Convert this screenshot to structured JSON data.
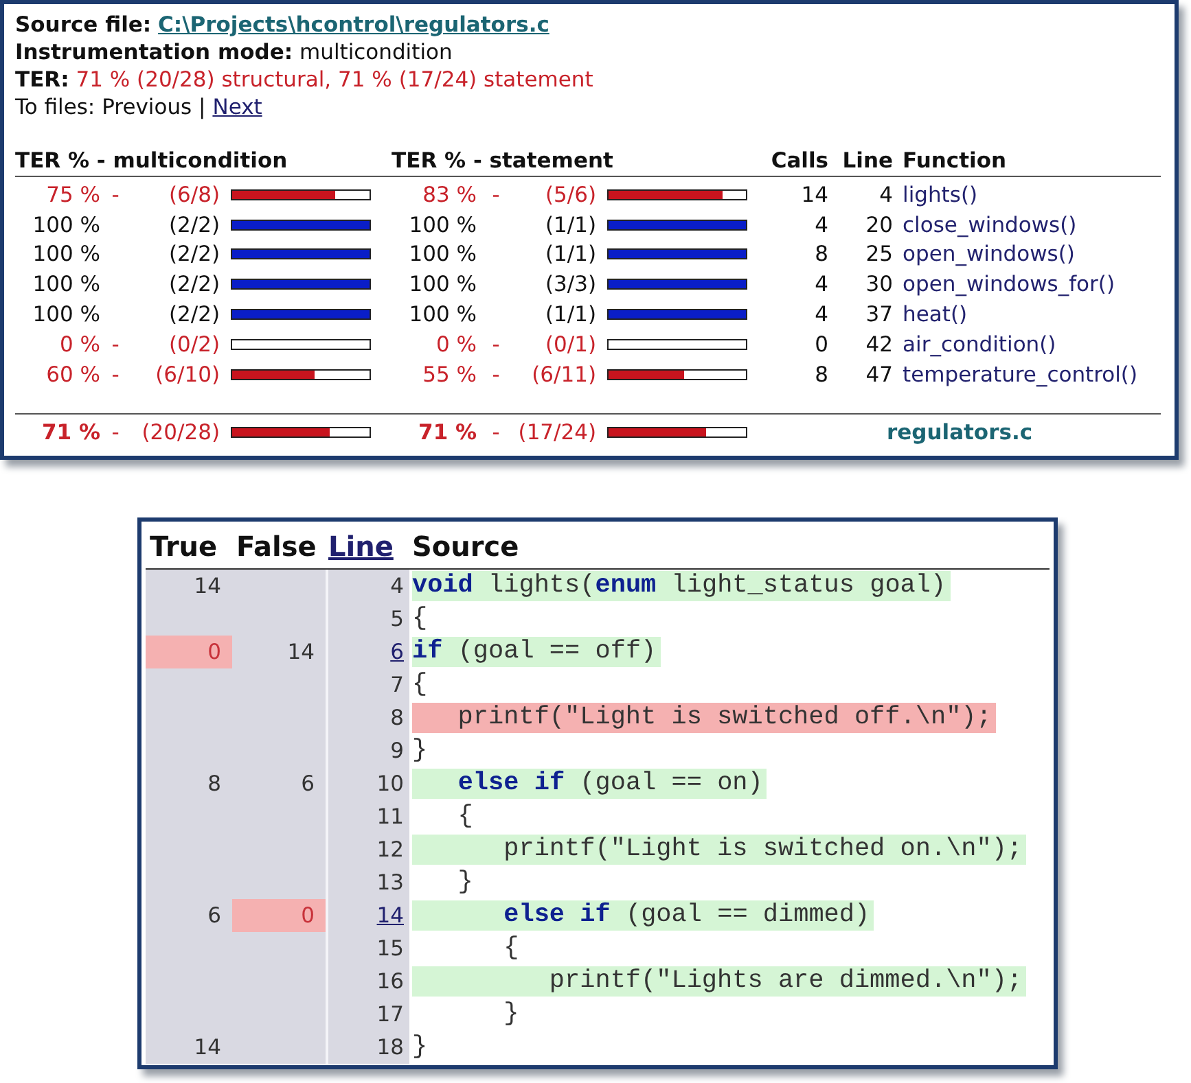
{
  "report": {
    "source_file_label": "Source file:",
    "source_file": "C:\\Projects\\hcontrol\\regulators.c",
    "mode_label": "Instrumentation mode:",
    "mode": "multicondition",
    "ter_label": "TER:",
    "ter": "71 % (20/28) structural, 71 % (17/24) statement",
    "nav_label": "To files:",
    "nav_previous": "Previous",
    "nav_separator": "|",
    "nav_next": "Next"
  },
  "columns": [
    "TER % - multicondition",
    "TER % - statement",
    "Calls",
    "Line",
    "Function"
  ],
  "rows": [
    {
      "complete": false,
      "multicondition": {
        "pct": "75 %",
        "dash": "-",
        "ratio": "(6/8)",
        "level": 0.75
      },
      "statement": {
        "pct": "83 %",
        "dash": "-",
        "ratio": "(5/6)",
        "level": 0.83
      },
      "calls": "14",
      "line": "4",
      "function": "lights()"
    },
    {
      "complete": true,
      "multicondition": {
        "pct": "100 %",
        "ratio": "(2/2)",
        "level": 1
      },
      "statement": {
        "pct": "100 %",
        "ratio": "(1/1)",
        "level": 1
      },
      "calls": "4",
      "line": "20",
      "function": "close_windows()"
    },
    {
      "complete": true,
      "multicondition": {
        "pct": "100 %",
        "ratio": "(2/2)",
        "level": 1
      },
      "statement": {
        "pct": "100 %",
        "ratio": "(1/1)",
        "level": 1
      },
      "calls": "8",
      "line": "25",
      "function": "open_windows()"
    },
    {
      "complete": true,
      "multicondition": {
        "pct": "100 %",
        "ratio": "(2/2)",
        "level": 1
      },
      "statement": {
        "pct": "100 %",
        "ratio": "(3/3)",
        "level": 1
      },
      "calls": "4",
      "line": "30",
      "function": "open_windows_for()"
    },
    {
      "complete": true,
      "multicondition": {
        "pct": "100 %",
        "ratio": "(2/2)",
        "level": 1
      },
      "statement": {
        "pct": "100 %",
        "ratio": "(1/1)",
        "level": 1
      },
      "calls": "4",
      "line": "37",
      "function": "heat()"
    },
    {
      "complete": false,
      "multicondition": {
        "pct": "0 %",
        "dash": "-",
        "ratio": "(0/2)",
        "level": 0
      },
      "statement": {
        "pct": "0 %",
        "dash": "-",
        "ratio": "(0/1)",
        "level": 0
      },
      "calls": "0",
      "line": "42",
      "function": "air_condition()"
    },
    {
      "complete": false,
      "multicondition": {
        "pct": "60 %",
        "dash": "-",
        "ratio": "(6/10)",
        "level": 0.6
      },
      "statement": {
        "pct": "55 %",
        "dash": "-",
        "ratio": "(6/11)",
        "level": 0.55
      },
      "calls": "8",
      "line": "47",
      "function": "temperature_control()"
    }
  ],
  "total": {
    "complete": false,
    "multicondition": {
      "pct": "71 %",
      "dash": "-",
      "ratio": "(20/28)",
      "level": 0.71
    },
    "statement": {
      "pct": "71 %",
      "dash": "-",
      "ratio": "(17/24)",
      "level": 0.71
    },
    "file": "regulators.c"
  },
  "source_columns": [
    "True",
    "False",
    "Line",
    "Source"
  ],
  "source_lines": [
    {
      "true_count": "14",
      "true_missed": false,
      "false_missed": false,
      "line": "4",
      "link": false,
      "code": "**void** lights(**enum** light_status goal)",
      "kind": "covered"
    },
    {
      "true_missed": false,
      "false_missed": false,
      "line": "5",
      "link": false,
      "code": "{",
      "kind": "plain"
    },
    {
      "true_count": "0",
      "false_count": "14",
      "true_missed": true,
      "false_missed": false,
      "line": "6",
      "link": true,
      "code": "**if** (goal == off)",
      "kind": "covered"
    },
    {
      "true_missed": false,
      "false_missed": false,
      "line": "7",
      "link": false,
      "code": "{",
      "kind": "plain"
    },
    {
      "true_missed": false,
      "false_missed": false,
      "line": "8",
      "link": false,
      "code": "   printf(\"Light is switched off.\\n\");",
      "kind": "missed"
    },
    {
      "true_missed": false,
      "false_missed": false,
      "line": "9",
      "link": false,
      "code": "}",
      "kind": "plain"
    },
    {
      "true_count": "8",
      "false_count": "6",
      "true_missed": false,
      "false_missed": false,
      "line": "10",
      "link": false,
      "code": "   **else** **if** (goal == on)",
      "kind": "covered"
    },
    {
      "true_missed": false,
      "false_missed": false,
      "line": "11",
      "link": false,
      "code": "   {",
      "kind": "plain"
    },
    {
      "true_missed": false,
      "false_missed": false,
      "line": "12",
      "link": false,
      "code": "      printf(\"Light is switched on.\\n\");",
      "kind": "covered"
    },
    {
      "true_missed": false,
      "false_missed": false,
      "line": "13",
      "link": false,
      "code": "   }",
      "kind": "plain"
    },
    {
      "true_count": "6",
      "false_count": "0",
      "true_missed": false,
      "false_missed": true,
      "line": "14",
      "link": true,
      "code": "      **else** **if** (goal == dimmed)",
      "kind": "covered"
    },
    {
      "true_missed": false,
      "false_missed": false,
      "line": "15",
      "link": false,
      "code": "      {",
      "kind": "plain"
    },
    {
      "true_missed": false,
      "false_missed": false,
      "line": "16",
      "link": false,
      "code": "         printf(\"Lights are dimmed.\\n\");",
      "kind": "covered"
    },
    {
      "true_missed": false,
      "false_missed": false,
      "line": "17",
      "link": false,
      "code": "      }",
      "kind": "plain"
    },
    {
      "true_count": "14",
      "true_missed": false,
      "false_missed": false,
      "line": "18",
      "link": false,
      "code": "}",
      "kind": "plain"
    }
  ]
}
